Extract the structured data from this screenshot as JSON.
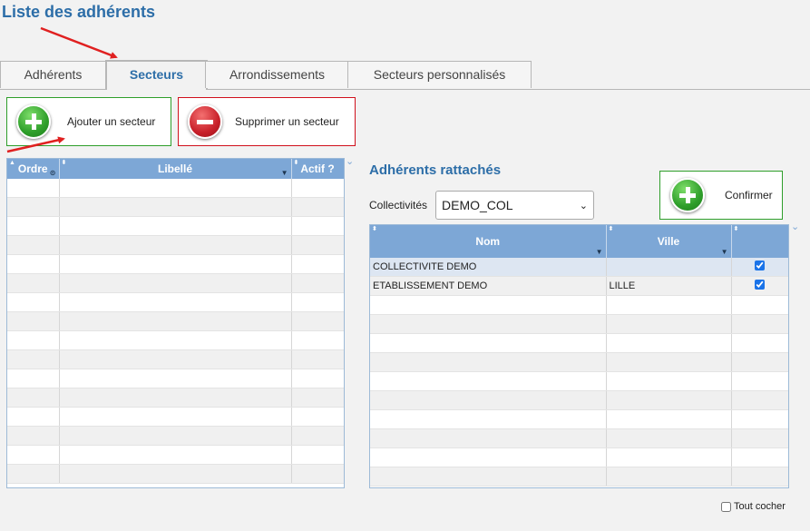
{
  "page": {
    "title": "Liste des adhérents"
  },
  "tabs": [
    {
      "label": "Adhérents"
    },
    {
      "label": "Secteurs"
    },
    {
      "label": "Arrondissements"
    },
    {
      "label": "Secteurs personnalisés"
    }
  ],
  "actions": {
    "add_label": "Ajouter un secteur",
    "delete_label": "Supprimer un secteur",
    "confirm_label": "Confirmer"
  },
  "sectors_grid": {
    "columns": [
      "Ordre",
      "Libellé",
      "Actif ?"
    ],
    "rows": []
  },
  "members": {
    "title": "Adhérents rattachés",
    "collectivity_label": "Collectivités",
    "collectivity_value": "DEMO_COL",
    "columns": [
      "Nom",
      "Ville",
      ""
    ],
    "rows": [
      {
        "nom": "COLLECTIVITE DEMO",
        "ville": "",
        "checked": true
      },
      {
        "nom": "ETABLISSEMENT DEMO",
        "ville": "LILLE",
        "checked": true
      }
    ],
    "select_all_label": "Tout cocher"
  },
  "colors": {
    "title": "#2d6ea8",
    "grid_header": "#7da7d6",
    "add_button_border": "#2e9e2a",
    "delete_button_border": "#d0101c",
    "annotation_arrow": "#e02020"
  }
}
